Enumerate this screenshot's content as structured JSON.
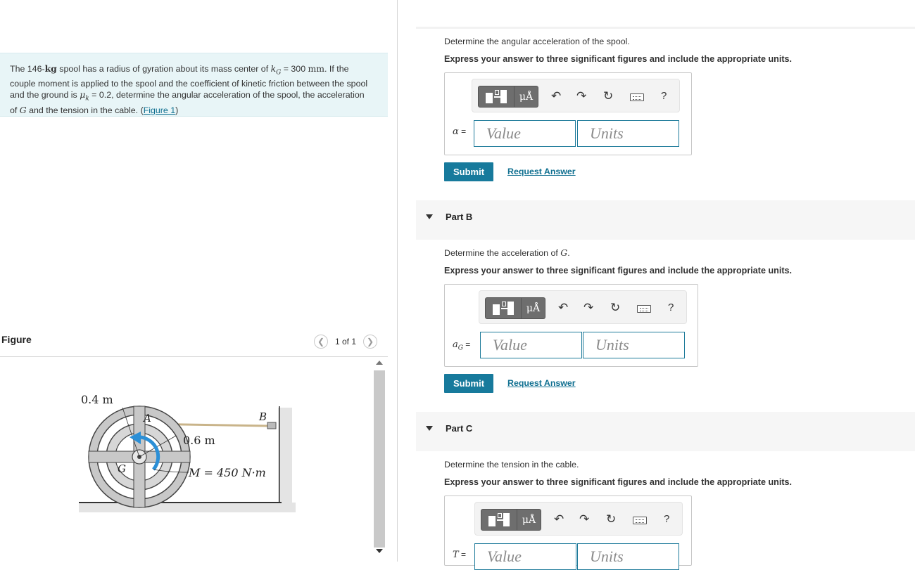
{
  "problem": {
    "text_1": "The 146-",
    "unit_kg": "kg",
    "text_2": " spool has a radius of gyration about its mass center of ",
    "k_symbol": "k",
    "k_sub": "G",
    "text_3": " = 300 ",
    "unit_mm": "mm",
    "text_4": ". If the couple moment is applied to the spool and the coefficient of kinetic friction between the spool and the ground is ",
    "mu_symbol": "μ",
    "mu_sub": "k",
    "text_5": " = 0.2, determine the angular acceleration of the spool, the acceleration of ",
    "g_symbol": "G",
    "text_6": " and the tension in the cable. (",
    "figure_link": "Figure 1",
    "text_7": ")"
  },
  "figure": {
    "title": "Figure",
    "counter": "1 of 1",
    "prev_icon": "chevron-left-icon",
    "next_icon": "chevron-right-icon",
    "labels": {
      "outer_radius": "0.4 m",
      "inner_radius": "0.6 m",
      "point_a": "A",
      "point_b": "B",
      "point_g": "G",
      "moment": "M = 450 N·m"
    }
  },
  "toolbar": {
    "template_icon": "templates-icon",
    "mu_label": "μÅ",
    "undo_icon": "undo-icon",
    "redo_icon": "redo-icon",
    "reset_icon": "reset-icon",
    "keyboard_icon": "keyboard-icon",
    "help_label": "?"
  },
  "part_a": {
    "question": "Determine the angular acceleration of the spool.",
    "instruction": "Express your answer to three significant figures and include the appropriate units.",
    "variable": "α",
    "eq": " =",
    "value_placeholder": "Value",
    "units_placeholder": "Units",
    "submit": "Submit",
    "request": "Request Answer"
  },
  "part_b": {
    "header": "Part B",
    "question_prefix": "Determine the acceleration of ",
    "question_symbol": "G",
    "question_suffix": ".",
    "instruction": "Express your answer to three significant figures and include the appropriate units.",
    "variable": "a",
    "variable_sub": "G",
    "eq": " =",
    "value_placeholder": "Value",
    "units_placeholder": "Units",
    "submit": "Submit",
    "request": "Request Answer"
  },
  "part_c": {
    "header": "Part C",
    "question": "Determine the tension in the cable.",
    "instruction": "Express your answer to three significant figures and include the appropriate units.",
    "variable": "T",
    "eq": " =",
    "value_placeholder": "Value",
    "units_placeholder": "Units"
  },
  "colors": {
    "accent": "#177a9c",
    "problem_bg": "#e8f5f7",
    "arrow_blue": "#2b8fd6"
  }
}
